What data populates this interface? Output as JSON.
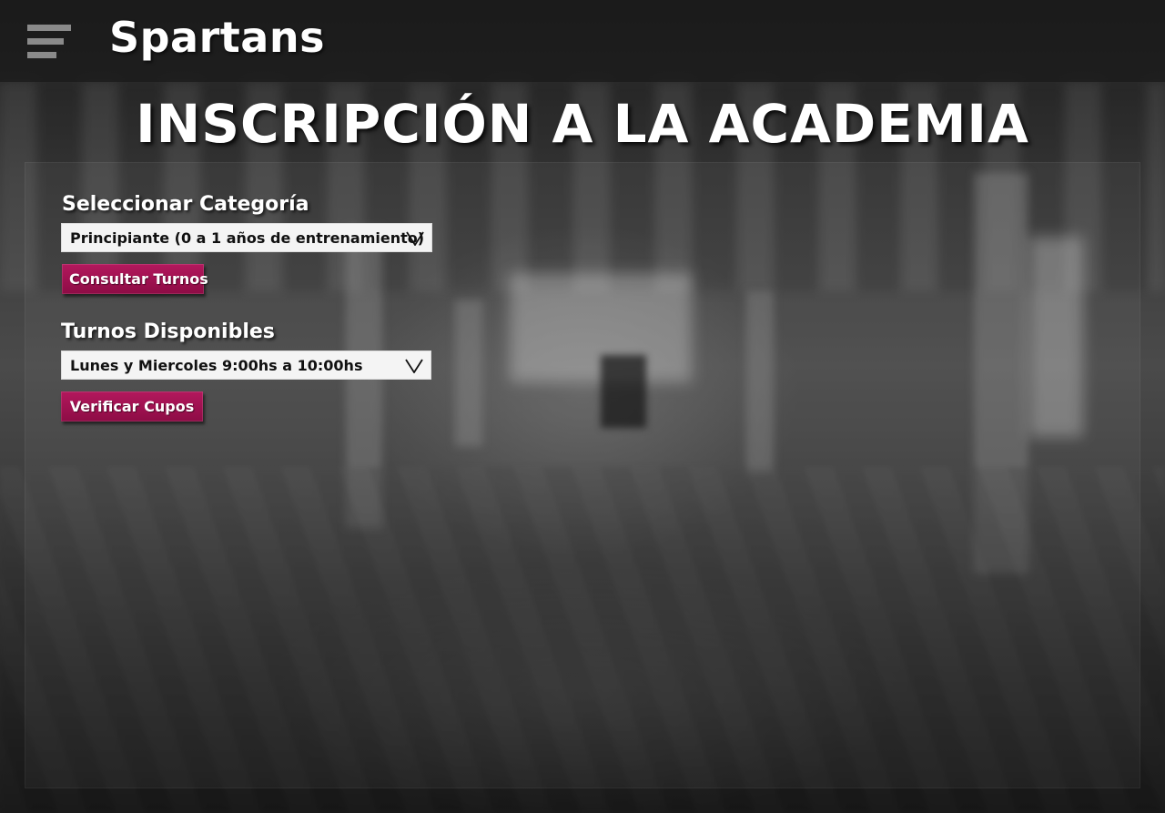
{
  "header": {
    "brand": "Spartans",
    "menu_icon": "hamburger-menu-icon"
  },
  "page": {
    "title": "INSCRIPCIÓN A LA ACADEMIA"
  },
  "category": {
    "label": "Seleccionar Categoría",
    "selected": "Principiante (0 a 1 años de entrenamiento)",
    "chevron_icon": "chevron-down-icon",
    "button_label": "Consultar Turnos"
  },
  "shifts": {
    "label": "Turnos Disponibles",
    "selected": "Lunes y Miercoles 9:00hs a 10:00hs",
    "chevron_icon": "chevron-down-icon",
    "button_label": "Verificar Cupos"
  },
  "colors": {
    "accent": "#9e1250",
    "topbar": "#191919",
    "text": "#ffffff"
  }
}
